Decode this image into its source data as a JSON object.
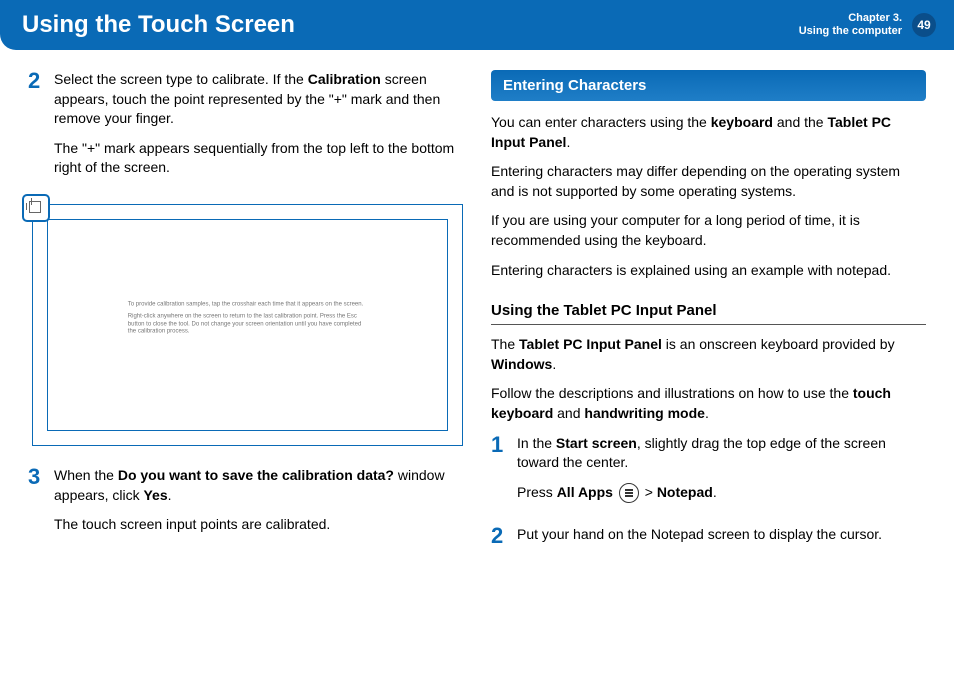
{
  "header": {
    "title": "Using the Touch Screen",
    "chapter_line1": "Chapter 3.",
    "chapter_line2": "Using the computer",
    "page": "49"
  },
  "left_col": {
    "step2_num": "2",
    "step2_p1_a": "Select the screen type to calibrate. If the ",
    "step2_p1_b": "Calibration",
    "step2_p1_c": " screen appears, touch the point represented by the \"+\" mark and then remove your finger.",
    "step2_p2": "The \"+\" mark appears sequentially from the top left to the bottom right of the screen.",
    "screenshot_text1": "To provide calibration samples, tap the crosshair each time that it appears on the screen.",
    "screenshot_text2": "Right-click anywhere on the screen to return to the last calibration point. Press the Esc button to close the tool. Do not change your screen orientation until you have completed the calibration process.",
    "step3_num": "3",
    "step3_p1_a": "When the ",
    "step3_p1_b": "Do you want to save the calibration data?",
    "step3_p1_c": " window appears, click ",
    "step3_p1_d": "Yes",
    "step3_p1_e": ".",
    "step3_p2": "The touch screen input points are calibrated."
  },
  "right_col": {
    "banner": "Entering Characters",
    "p1_a": "You can enter characters using the ",
    "p1_b": "keyboard",
    "p1_c": " and the ",
    "p1_d": "Tablet PC Input Panel",
    "p1_e": ".",
    "p2": "Entering characters may differ depending on the operating system and is not supported by some operating systems.",
    "p3": "If you are using your computer for a long period of time, it is recommended using the keyboard.",
    "p4": "Entering characters is explained using an example with notepad.",
    "sub": "Using the Tablet PC Input Panel",
    "sp1_a": "The ",
    "sp1_b": "Tablet PC Input Panel",
    "sp1_c": " is an onscreen keyboard provided by ",
    "sp1_d": "Windows",
    "sp1_e": ".",
    "sp2_a": "Follow the descriptions and illustrations on how to use the ",
    "sp2_b": "touch keyboard",
    "sp2_c": " and ",
    "sp2_d": "handwriting mode",
    "sp2_e": ".",
    "s1_num": "1",
    "s1_p1_a": "In the ",
    "s1_p1_b": "Start screen",
    "s1_p1_c": ", slightly drag the top edge of the screen toward the center.",
    "s1_p2_a": "Press ",
    "s1_p2_b": "All Apps",
    "s1_p2_c": " > ",
    "s1_p2_d": "Notepad",
    "s1_p2_e": ".",
    "s2_num": "2",
    "s2_p1": "Put your hand on the Notepad screen to display the cursor."
  }
}
